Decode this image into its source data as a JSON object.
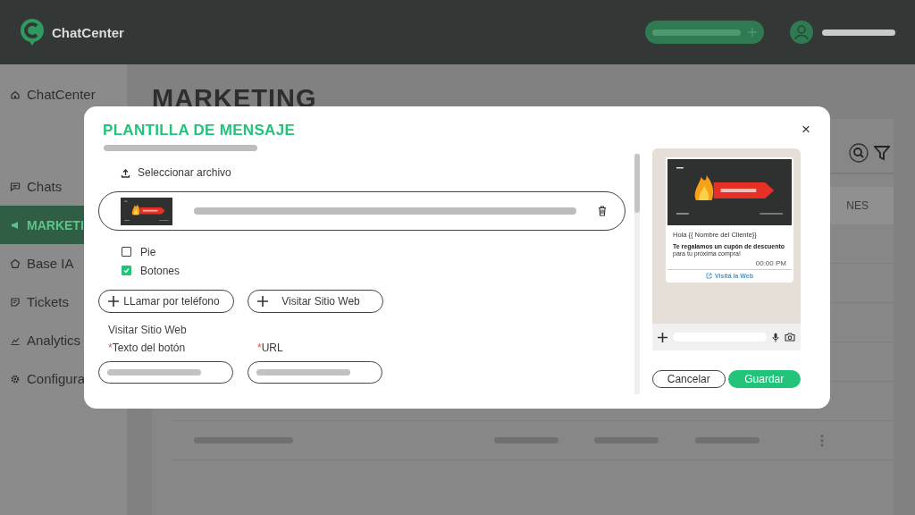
{
  "header": {
    "brand": "ChatCenter"
  },
  "sidebar": {
    "items": [
      {
        "label": "ChatCenter",
        "selected": false
      },
      {
        "label": "Chats",
        "selected": false
      },
      {
        "label": "MARKETI",
        "selected": true
      },
      {
        "label": "Base IA",
        "selected": false
      },
      {
        "label": "Tickets",
        "selected": false
      },
      {
        "label": "Analytics",
        "selected": false
      },
      {
        "label": "Configura",
        "selected": false
      }
    ]
  },
  "page": {
    "title": "MARKETING",
    "table": {
      "column_header": "NES"
    }
  },
  "modal": {
    "title": "PLANTILLA DE MENSAJE",
    "close": "×",
    "upload_label": "Seleccionar archivo",
    "options": [
      {
        "label": "Pie",
        "checked": false
      },
      {
        "label": "Botones",
        "checked": true
      }
    ],
    "add_buttons": [
      "LLamar por teléfono",
      "Visitar Sitio Web"
    ],
    "section_title": "Visitar Sitio Web",
    "fields": [
      {
        "required_mark": "*",
        "label": "Texto del botón"
      },
      {
        "required_mark": "*",
        "label": "URL"
      }
    ],
    "preview": {
      "greeting": "Hola {{ Nombre del Cliente}}",
      "message_title": "Te regalamos un cupón de descuento",
      "message_body": "para tu próxima compra!",
      "time": "00:00 PM",
      "link": "Visitá la Web"
    },
    "buttons": [
      {
        "label": "Cancelar",
        "kind": "secondary"
      },
      {
        "label": "Guardar",
        "kind": "primary"
      }
    ]
  }
}
